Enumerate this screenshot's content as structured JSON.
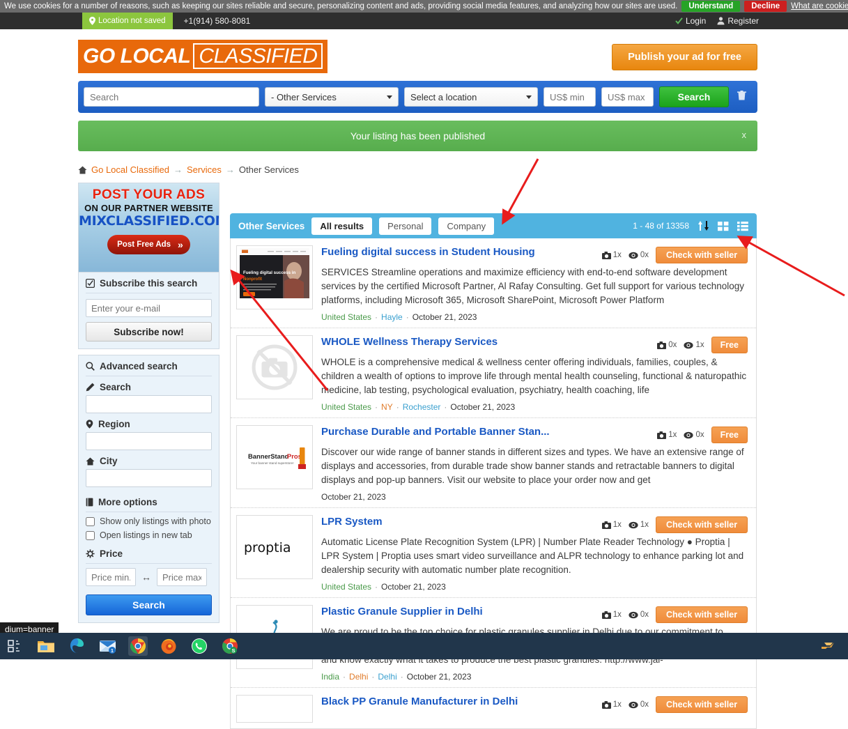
{
  "cookie": {
    "text": "We use cookies for a number of reasons, such as keeping our sites reliable and secure, personalizing content and ads, providing social media features, and analyzing how our sites are used.",
    "understand": "Understand",
    "decline": "Decline",
    "link": "What are cookies?"
  },
  "topbar": {
    "location_badge": "Location not saved",
    "phone": "+1(914) 580-8081",
    "login": "Login",
    "register": "Register"
  },
  "header": {
    "logo_part1": "GO LOCAL",
    "logo_part2": "CLASSIFIED",
    "publish_button": "Publish your ad for free"
  },
  "searchbar": {
    "query_placeholder": "Search",
    "query_value": "",
    "category_selected": "- Other Services",
    "location_selected": "Select a location",
    "price_min_placeholder": "US$ min",
    "price_max_placeholder": "US$ max",
    "search_button": "Search",
    "clear_icon": "trash-icon"
  },
  "flash": {
    "message": "Your listing has been published",
    "close": "x"
  },
  "breadcrumb": {
    "home_icon": "home-icon",
    "items": [
      "Go Local Classified",
      "Services",
      "Other Services"
    ],
    "separator": "→"
  },
  "sidebar": {
    "promo": {
      "line1": "POST YOUR ADS",
      "line2": "ON OUR PARTNER WEBSITE",
      "line3": "MIXCLASSIFIED.COM",
      "button": "Post Free Ads",
      "chevron": "»"
    },
    "subscribe": {
      "title": "Subscribe this search",
      "title_icon": "check-square-icon",
      "email_placeholder": "Enter your e-mail",
      "email_value": "",
      "button": "Subscribe now!"
    },
    "advanced": {
      "title": "Advanced search",
      "title_icon": "search-icon",
      "search_label": "Search",
      "search_icon": "pencil-icon",
      "search_value": "",
      "region_label": "Region",
      "region_icon": "map-pin-icon",
      "region_value": "",
      "city_label": "City",
      "city_icon": "home-icon",
      "city_value": "",
      "more_options_label": "More options",
      "more_options_icon": "book-icon",
      "checkbox_photo": "Show only listings with photo",
      "checkbox_photo_checked": false,
      "checkbox_newtab": "Open listings in new tab",
      "checkbox_newtab_checked": false,
      "price_label": "Price",
      "price_icon": "gear-icon",
      "price_min_placeholder": "Price min.",
      "price_max_placeholder": "Price max.",
      "price_arrows": "↔",
      "search_button": "Search"
    }
  },
  "results": {
    "category": "Other Services",
    "tabs": [
      {
        "label": "All results",
        "active": true
      },
      {
        "label": "Personal",
        "active": false
      },
      {
        "label": "Company",
        "active": false
      }
    ],
    "count": "1 - 48 of 13358",
    "sort_icon": "sort-updown-icon",
    "grid_icon": "grid-view-icon",
    "list_icon": "list-view-icon",
    "items": [
      {
        "title": "Fueling digital success in Student Housing",
        "description": "SERVICES Streamline operations and maximize efficiency with end-to-end software development services by the certified Microsoft Partner, Al Rafay Consulting. Get full support for various technology platforms, including Microsoft 365, Microsoft SharePoint, Microsoft Power Platform",
        "photos": "1x",
        "views": "0x",
        "price": "Check with seller",
        "price_type": "check",
        "country": "United States",
        "region": "",
        "city": "Hayle",
        "date": "October 21, 2023",
        "thumb": "screenshot-dark-hero"
      },
      {
        "title": "WHOLE Wellness Therapy Services",
        "description": "WHOLE is a comprehensive medical & wellness center offering individuals, families, couples, & children a wealth of options to improve life through mental health counseling, functional & naturopathic medicine, lab testing, psychological evaluation, psychiatry, health coaching, life",
        "photos": "0x",
        "views": "1x",
        "price": "Free",
        "price_type": "free",
        "country": "United States",
        "region": "NY",
        "city": "Rochester",
        "date": "October 21, 2023",
        "thumb": "no-photo"
      },
      {
        "title": "Purchase Durable and Portable Banner Stan...",
        "description": "Discover our wide range of banner stands in different sizes and types. We have an extensive range of displays and accessories, from durable trade show banner stands and retractable banners to digital displays and pop-up banners. Visit our website to place your order now and get",
        "photos": "1x",
        "views": "0x",
        "price": "Free",
        "price_type": "free",
        "country": "",
        "region": "",
        "city": "",
        "date": "October 21, 2023",
        "thumb": "bannerstandpros-logo"
      },
      {
        "title": "LPR System",
        "description": "Automatic License Plate Recognition System (LPR) | Number Plate Reader Technology ● Proptia | LPR System | Proptia uses smart video surveillance and ALPR technology to enhance parking lot and dealership security with automatic number plate recognition.",
        "photos": "1x",
        "views": "1x",
        "price": "Check with seller",
        "price_type": "check",
        "country": "United States",
        "region": "",
        "city": "",
        "date": "October 21, 2023",
        "thumb": "proptia-logo"
      },
      {
        "title": "Plastic Granule Supplier in Delhi",
        "description": "We are proud to be the top choice for plastic granules supplier in Delhi due to our commitment to quality and service. Our experienced team of professionals have years of experience in the industry and know exactly what it takes to produce the best plastic granules. http://www.jai-",
        "photos": "1x",
        "views": "0x",
        "price": "Check with seller",
        "price_type": "check",
        "country": "India",
        "region": "Delhi",
        "city": "Delhi",
        "date": "October 21, 2023",
        "thumb": "jai-international-logo"
      },
      {
        "title": "Black PP Granule Manufacturer in Delhi",
        "description": "",
        "photos": "1x",
        "views": "0x",
        "price": "Check with seller",
        "price_type": "check",
        "country": "",
        "region": "",
        "city": "",
        "date": "",
        "thumb": "blank"
      }
    ]
  },
  "status_tip": "dium=banner",
  "taskbar": {
    "icons": [
      "task-view-icon",
      "file-explorer-icon",
      "edge-icon",
      "mail-icon",
      "chrome-icon",
      "firefox-icon",
      "whatsapp-icon",
      "chrome-s-icon"
    ],
    "tray": [
      "notification-icon"
    ]
  },
  "colors": {
    "accent_orange": "#e8690b",
    "brand_blue": "#1a59c4",
    "results_header": "#50b3e0",
    "success_green": "#57ad4d",
    "annotation_red": "#e81c1c"
  }
}
